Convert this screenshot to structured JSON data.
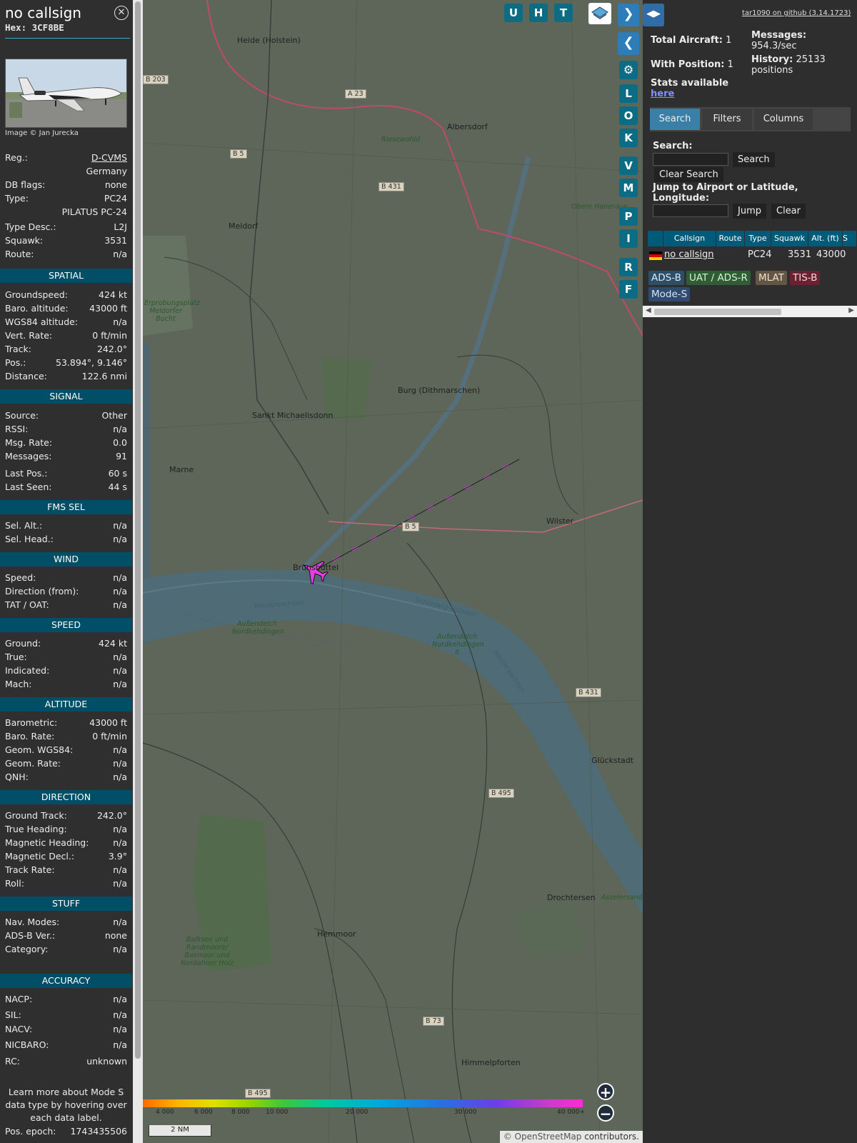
{
  "aircraft": {
    "callsign": "no callsign",
    "hex": "Hex: 3CF8BE",
    "photo_credit": "Image © Jan Jurecka",
    "details": [
      {
        "label": "Reg.:",
        "value": "D-CVMS",
        "link": true
      },
      {
        "label": "",
        "value": "Germany"
      },
      {
        "label": "DB flags:",
        "value": "none"
      },
      {
        "label": "Type:",
        "value": "PC24"
      },
      {
        "label": "",
        "value": "PILATUS PC-24"
      },
      {
        "label": "Type Desc.:",
        "value": "L2J"
      },
      {
        "label": "Squawk:",
        "value": "3531"
      },
      {
        "label": "Route:",
        "value": "n/a"
      }
    ]
  },
  "sections": [
    {
      "title": "SPATIAL",
      "rows": [
        {
          "label": "Groundspeed:",
          "value": "424 kt"
        },
        {
          "label": "Baro. altitude:",
          "value": "43000 ft"
        },
        {
          "label": "WGS84 altitude:",
          "value": "n/a"
        },
        {
          "label": "Vert. Rate:",
          "value": "0 ft/min"
        },
        {
          "label": "Track:",
          "value": "242.0°"
        },
        {
          "label": "Pos.:",
          "value": "53.894°, 9.146°"
        },
        {
          "label": "Distance:",
          "value": "122.6 nmi"
        }
      ]
    },
    {
      "title": "SIGNAL",
      "rows": [
        {
          "label": "Source:",
          "value": "Other"
        },
        {
          "label": "RSSI:",
          "value": "n/a"
        },
        {
          "label": "Msg. Rate:",
          "value": "0.0"
        },
        {
          "label": "Messages:",
          "value": "91"
        },
        {
          "label": "Last Pos.:",
          "value": "60 s"
        },
        {
          "label": "Last Seen:",
          "value": "44 s"
        }
      ]
    },
    {
      "title": "FMS SEL",
      "rows": [
        {
          "label": "Sel. Alt.:",
          "value": "n/a"
        },
        {
          "label": "Sel. Head.:",
          "value": "n/a"
        }
      ]
    },
    {
      "title": "WIND",
      "rows": [
        {
          "label": "Speed:",
          "value": "n/a"
        },
        {
          "label": "Direction (from):",
          "value": "n/a"
        },
        {
          "label": "TAT / OAT:",
          "value": "n/a"
        }
      ]
    },
    {
      "title": "SPEED",
      "rows": [
        {
          "label": "Ground:",
          "value": "424 kt"
        },
        {
          "label": "True:",
          "value": "n/a"
        },
        {
          "label": "Indicated:",
          "value": "n/a"
        },
        {
          "label": "Mach:",
          "value": "n/a"
        }
      ]
    },
    {
      "title": "ALTITUDE",
      "rows": [
        {
          "label": "Barometric:",
          "value": "43000 ft"
        },
        {
          "label": "Baro. Rate:",
          "value": "0 ft/min"
        },
        {
          "label": "Geom. WGS84:",
          "value": "n/a"
        },
        {
          "label": "Geom. Rate:",
          "value": "n/a"
        },
        {
          "label": "QNH:",
          "value": "n/a"
        }
      ]
    },
    {
      "title": "DIRECTION",
      "rows": [
        {
          "label": "Ground Track:",
          "value": "242.0°"
        },
        {
          "label": "True Heading:",
          "value": "n/a"
        },
        {
          "label": "Magnetic Heading:",
          "value": "n/a"
        },
        {
          "label": "Magnetic Decl.:",
          "value": "3.9°"
        },
        {
          "label": "Track Rate:",
          "value": "n/a"
        },
        {
          "label": "Roll:",
          "value": "n/a"
        }
      ]
    },
    {
      "title": "STUFF",
      "rows": [
        {
          "label": "Nav. Modes:",
          "value": "n/a"
        },
        {
          "label": "ADS-B Ver.:",
          "value": "none"
        },
        {
          "label": "Category:",
          "value": "n/a"
        }
      ]
    },
    {
      "title": "ACCURACY",
      "rows": [
        {
          "label": "NACP:",
          "value": "n/a"
        },
        {
          "label": "SIL:",
          "value": "n/a"
        },
        {
          "label": "NACV:",
          "value": "n/a"
        },
        {
          "label": "NICBARO:",
          "value": "n/a"
        },
        {
          "label": "RC:",
          "value": "unknown"
        }
      ]
    }
  ],
  "learn_more": "Learn more about Mode S data type by hovering over each data label.",
  "pos_epoch": {
    "label": "Pos. epoch:",
    "value": "1743435506"
  },
  "map": {
    "places": [
      {
        "name": "Heide (Holstein)"
      },
      {
        "name": "Albersdorf"
      },
      {
        "name": "Meldorf"
      },
      {
        "name": "Burg (Dithmarschen)"
      },
      {
        "name": "Sankt Michaelisdonn"
      },
      {
        "name": "Marne"
      },
      {
        "name": "Wilster"
      },
      {
        "name": "Brunsbüttel"
      },
      {
        "name": "Glückstadt"
      },
      {
        "name": "Drochtersen"
      },
      {
        "name": "Hemmoor"
      },
      {
        "name": "Himmelpforten"
      }
    ],
    "roads": [
      "B 203",
      "A 23",
      "B 5",
      "B 431",
      "B 5",
      "B 431",
      "B 495",
      "B 73",
      "B 495"
    ],
    "nature": [
      "Riesewohld",
      "Obere Haneraue",
      "Erprobungsplatz Meldorfer Bucht",
      "Außendeich Nordkehdingen",
      "Außendeich Nordkehdingen II",
      "Balksee und Randmoore/ Basmoor und Nordahner Holz",
      "Asselersand"
    ],
    "water": [
      "Niedersachsen",
      "Schleswig-Holstein",
      "Niedersachsen"
    ],
    "controls": {
      "u": "U",
      "h": "H",
      "t": "T",
      "l": "L",
      "o": "O",
      "k": "K",
      "v": "V",
      "m": "M",
      "p": "P",
      "i": "I",
      "r": "R",
      "f": "F",
      "zoom_in": "+",
      "zoom_out": "−"
    },
    "scale": "2 NM",
    "altitude_ticks": [
      "4 000",
      "6 000",
      "8 000",
      "10 000",
      "20 000",
      "30 000",
      "40 000+"
    ],
    "attribution_osm": "© OpenStreetMap",
    "attribution_rest": " contributors."
  },
  "sidebar": {
    "github": "tar1090 on github (3.14.1723)",
    "total_aircraft_label": "Total Aircraft:",
    "total_aircraft": "1",
    "with_position_label": "With Position:",
    "with_position": "1",
    "stats_label": "Stats available",
    "stats_link": "here",
    "messages_label": "Messages:",
    "messages_value": "954.3/sec",
    "history_label": "History:",
    "history_value": "25133 positions",
    "tabs": [
      "Search",
      "Filters",
      "Columns"
    ],
    "search_label": "Search:",
    "search_button": "Search",
    "clear_search_button": "Clear Search",
    "jump_label": "Jump to Airport or Latitude, Longitude:",
    "jump_button": "Jump",
    "clear_button": "Clear",
    "table_headers": [
      "Callsign",
      "Route",
      "Type",
      "Squawk",
      "Alt. (ft)",
      "S"
    ],
    "table_row": {
      "callsign": "no callsign",
      "route": "",
      "type": "PC24",
      "squawk": "3531",
      "alt": "43000"
    },
    "badges": [
      {
        "label": "ADS-B",
        "color": "#2d4e67"
      },
      {
        "label": "UAT / ADS-R",
        "color": "#2f5e34"
      },
      {
        "label": "MLAT",
        "color": "#645645"
      },
      {
        "label": "TIS-B",
        "color": "#6a2230"
      },
      {
        "label": "Mode-S",
        "color": "#2f4b70"
      }
    ]
  }
}
